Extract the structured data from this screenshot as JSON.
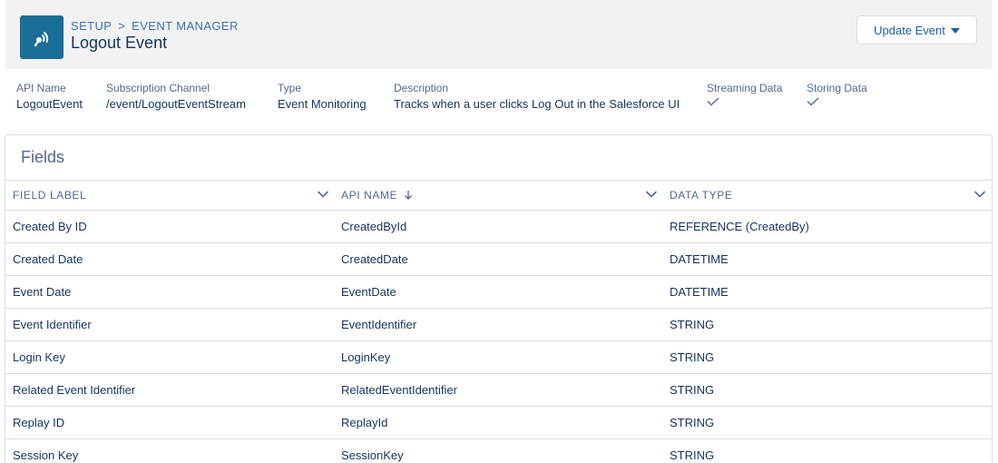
{
  "header": {
    "breadcrumb": [
      "SETUP",
      "EVENT MANAGER"
    ],
    "breadcrumb_separator": ">",
    "title": "Logout Event",
    "update_button_label": "Update Event",
    "app_icon": "broadcast-icon"
  },
  "details": {
    "api_name": {
      "label": "API Name",
      "value": "LogoutEvent"
    },
    "subscription_channel": {
      "label": "Subscription Channel",
      "value": "/event/LogoutEventStream"
    },
    "type": {
      "label": "Type",
      "value": "Event Monitoring"
    },
    "description": {
      "label": "Description",
      "value": "Tracks when a user clicks Log Out in the Salesforce UI"
    },
    "streaming_data": {
      "label": "Streaming Data",
      "checked": true
    },
    "storing_data": {
      "label": "Storing Data",
      "checked": true
    }
  },
  "fields_card": {
    "title": "Fields",
    "columns": [
      {
        "label": "FIELD LABEL",
        "sorted": false
      },
      {
        "label": "API NAME",
        "sorted": true,
        "sort_direction": "desc"
      },
      {
        "label": "DATA TYPE",
        "sorted": false
      }
    ],
    "rows": [
      {
        "label": "Created By ID",
        "api_name": "CreatedById",
        "type": "REFERENCE (CreatedBy)"
      },
      {
        "label": "Created Date",
        "api_name": "CreatedDate",
        "type": "DATETIME"
      },
      {
        "label": "Event Date",
        "api_name": "EventDate",
        "type": "DATETIME"
      },
      {
        "label": "Event Identifier",
        "api_name": "EventIdentifier",
        "type": "STRING"
      },
      {
        "label": "Login Key",
        "api_name": "LoginKey",
        "type": "STRING"
      },
      {
        "label": "Related Event Identifier",
        "api_name": "RelatedEventIdentifier",
        "type": "STRING"
      },
      {
        "label": "Replay ID",
        "api_name": "ReplayId",
        "type": "STRING"
      },
      {
        "label": "Session Key",
        "api_name": "SessionKey",
        "type": "STRING"
      }
    ]
  },
  "colors": {
    "icon_bg": "#1a6d96",
    "link": "#1b5fa8",
    "text": "#16325c",
    "muted": "#54698d",
    "border": "#d8dde6"
  }
}
